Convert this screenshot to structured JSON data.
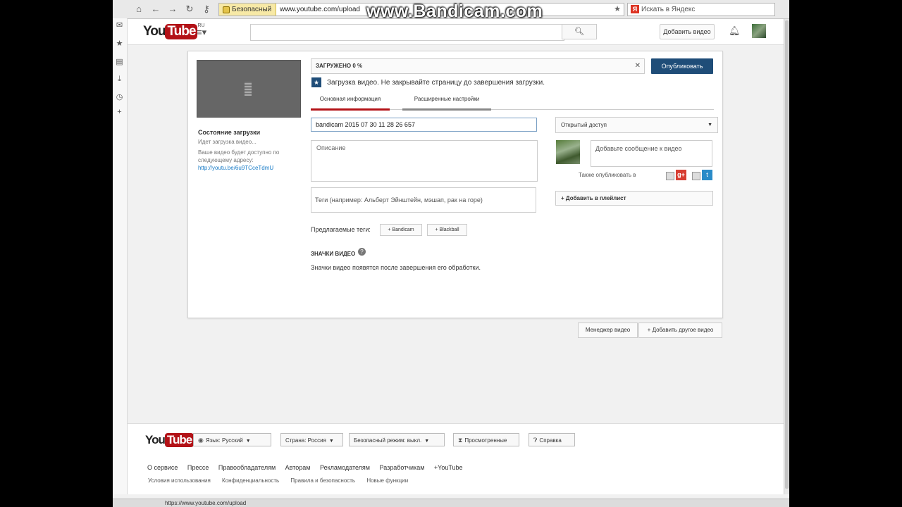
{
  "browser": {
    "secure_label": "Безопасный",
    "url": "www.youtube.com/upload",
    "yandex_placeholder": "Искать в Яндекс",
    "watermark": "www.Bandicam.com",
    "status_url": "https://www.youtube.com/upload"
  },
  "header": {
    "logo_you": "You",
    "logo_tube": "Tube",
    "logo_region": "RU",
    "search_placeholder": "",
    "add_video_label": "Добавить видео"
  },
  "left": {
    "upload_state_title": "Состояние загрузки",
    "upload_progress": "Идет загрузка видео...",
    "avail_text": "Ваше видео будет доступно по следующему адресу:",
    "avail_link": "http://youtu.be/6u9TCceTdmU"
  },
  "upload": {
    "progress_label": "ЗАГРУЖЕНО 0 %",
    "progress_value": 0,
    "publish_label": "Опубликовать",
    "notice": "Загрузка видео. Не закрывайте страницу до завершения загрузки."
  },
  "tabs": [
    {
      "label": "Основная информация",
      "active": true
    },
    {
      "label": "Расширенные настройки",
      "active": false
    }
  ],
  "form": {
    "title_value": "bandicam 2015 07 30 11 28 26 657",
    "description_placeholder": "Описание",
    "tags_placeholder": "Теги (например: Альберт Эйнштейн, мэшап, рак на горе)",
    "suggested_label": "Предлагаемые теги:",
    "suggested_tags": [
      "+ Bandicam",
      "+ Blackball"
    ],
    "thumbs_title": "ЗНАЧКИ ВИДЕО",
    "thumbs_note": "Значки видео появятся после завершения его обработки."
  },
  "right": {
    "privacy_value": "Открытый доступ",
    "share_placeholder": "Добавьте сообщение к видео",
    "share_also": "Также опубликовать в",
    "playlist_label": "+ Добавить в плейлист"
  },
  "actions": {
    "manager_label": "Менеджер видео",
    "add_other_label": "+ Добавить другое видео"
  },
  "footer": {
    "language": "Язык: Русский",
    "country": "Страна: Россия",
    "safe_mode": "Безопасный режим: выкл.",
    "history": "Просмотренные",
    "help": "Справка",
    "links": [
      "О сервисе",
      "Прессе",
      "Правообладателям",
      "Авторам",
      "Рекламодателям",
      "Разработчикам",
      "+YouTube"
    ],
    "links2": [
      "Условия использования",
      "Конфиденциальность",
      "Правила и безопасность",
      "Новые функции"
    ]
  }
}
